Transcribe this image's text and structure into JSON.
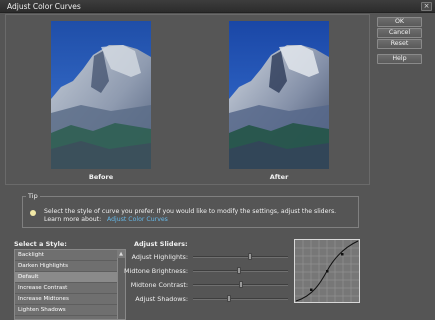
{
  "window": {
    "title": "Adjust Color Curves",
    "close_glyph": "×"
  },
  "buttons": {
    "ok": "OK",
    "cancel": "Cancel",
    "reset": "Reset",
    "help": "Help"
  },
  "preview": {
    "before_label": "Before",
    "after_label": "After"
  },
  "tip": {
    "legend": "Tip",
    "icon": "lightbulb-icon",
    "text": "Select the style of curve you prefer. If you would like to modify the settings, adjust the sliders.",
    "learn_prefix": "Learn more about:",
    "learn_link": "Adjust Color Curves"
  },
  "styles": {
    "header": "Select a Style:",
    "selected_index": 2,
    "items": [
      "Backlight",
      "Darken Highlights",
      "Default",
      "Increase Contrast",
      "Increase Midtones",
      "Lighten Shadows"
    ]
  },
  "sliders": {
    "header": "Adjust Sliders:",
    "items": [
      {
        "label": "Adjust Highlights:",
        "value": 0.6
      },
      {
        "label": "Midtone Brightness:",
        "value": 0.48
      },
      {
        "label": "Midtone Contrast:",
        "value": 0.5
      },
      {
        "label": "Adjust Shadows:",
        "value": 0.37
      }
    ]
  },
  "colors": {
    "window_bg": "#555555",
    "link": "#65b8e8",
    "sky_before": "#2a58b8",
    "sky_after": "#2550b5"
  }
}
